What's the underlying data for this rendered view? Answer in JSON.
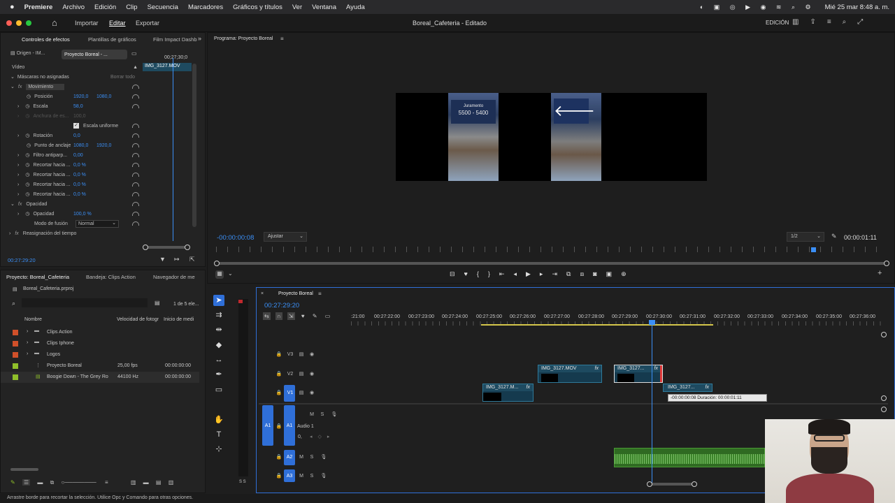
{
  "menubar": {
    "app": "Premiere",
    "items": [
      "Archivo",
      "Edición",
      "Clip",
      "Secuencia",
      "Marcadores",
      "Gráficos y títulos",
      "Ver",
      "Ventana",
      "Ayuda"
    ],
    "datetime": "Mié 25 mar 8:48 a. m."
  },
  "titlebar": {
    "tabs": [
      "Importar",
      "Editar",
      "Exportar"
    ],
    "title": "Boreal_Cafeteria - Editado",
    "workspace": "EDICIÓN"
  },
  "effects_panel": {
    "tabs": [
      "Controles de efectos",
      "Plantillas de gráficos",
      "Film Impact Dashb"
    ],
    "source_tab": "Origen - IM...",
    "sequence_tab": "Proyecto Boreal - ...",
    "mini_time": "00;27;30;0",
    "clip_name": "IMG_3127.MOV",
    "section_video": "Vídeo",
    "masks": "Máscaras no asignadas",
    "clear_all": "Borrar todo",
    "motion": "Movimiento",
    "position_label": "Posición",
    "position_x": "1920,0",
    "position_y": "1080,0",
    "scale_label": "Escala",
    "scale_value": "58,0",
    "width_label": "Anchura de es...",
    "width_value": "100,0",
    "uniform_scale": "Escala uniforme",
    "rotation_label": "Rotación",
    "rotation_value": "0,0",
    "anchor_label": "Punto de anclaje",
    "anchor_x": "1080,0",
    "anchor_y": "1920,0",
    "flicker_label": "Filtro antiparp...",
    "flicker_value": "0,00",
    "crop_labels": [
      "Recortar hacia ...",
      "Recortar hacia ...",
      "Recortar hacia ...",
      "Recortar hacia ..."
    ],
    "crop_values": [
      "0,0 %",
      "0,0 %",
      "0,0 %",
      "0,0 %"
    ],
    "opacity_section": "Opacidad",
    "opacity_label": "Opacidad",
    "opacity_value": "100,0 %",
    "blend_label": "Modo de fusión",
    "blend_value": "Normal",
    "time_remap": "Reasignación del tiempo",
    "timecode": "00:27:29:20"
  },
  "program": {
    "tab": "Programa: Proyecto Boreal",
    "timecode": "-00:00:00:08",
    "fit": "Ajustar",
    "resolution": "1/2",
    "duration": "00:00:01:11",
    "frame_text_1": "5500 - 5400",
    "frame_text_2": "Juramento"
  },
  "project": {
    "tabs": [
      "Proyecto: Boreal_Cafeteria",
      "Bandeja: Clips Action",
      "Navegador de me"
    ],
    "file": "Boreal_Cafeteria.prproj",
    "count": "1 de 5 ele...",
    "col_name": "Nombre",
    "col_fps": "Velocidad de fotogr",
    "col_start": "Inicio de medi",
    "items": [
      {
        "name": "Clips Action",
        "fps": "",
        "start": "",
        "color": "#d0502a"
      },
      {
        "name": "Clips Iphone",
        "fps": "",
        "start": "",
        "color": "#d0502a"
      },
      {
        "name": "Logos",
        "fps": "",
        "start": "",
        "color": "#d0502a"
      },
      {
        "name": "Proyecto Boreal",
        "fps": "25,00 fps",
        "start": "00:00:00:00",
        "color": "#8fbf2a"
      },
      {
        "name": "Boogie Down - The Grey Ro",
        "fps": "44100 Hz",
        "start": "00:00:00:00",
        "color": "#8fbf2a"
      }
    ]
  },
  "timeline": {
    "tab": "Proyecto Boreal",
    "timecode": "00:27:29:20",
    "ticks": [
      ":21:00",
      "00:27:22:00",
      "00:27:23:00",
      "00:27:24:00",
      "00:27:25:00",
      "00:27:26:00",
      "00:27:27:00",
      "00:27:28:00",
      "00:27:29:00",
      "00:27:30:00",
      "00:27:31:00",
      "00:27:32:00",
      "00:27:33:00",
      "00:27:34:00",
      "00:27:35:00",
      "00:27:36:00"
    ],
    "tracks": {
      "v3": "V3",
      "v2": "V2",
      "v1": "V1",
      "a1": "A1",
      "audio1": "Audio 1",
      "a2": "A2",
      "a3": "A3",
      "m": "M",
      "s": "S"
    },
    "audio_level": "0,",
    "clips": {
      "v2a": "IMG_3127.MOV",
      "v2b": "IMG_3127...",
      "v1a": "IMG_3127.M...",
      "v1b": "IMG_3127..."
    },
    "tooltip": "-00:00:00:08 Duración: 00:00:01:11",
    "fx": "fx"
  },
  "statusbar": "Arrastre borde para recortar la selección. Utilice Opc y Comando para otras opciones.",
  "meter_label": "S S"
}
